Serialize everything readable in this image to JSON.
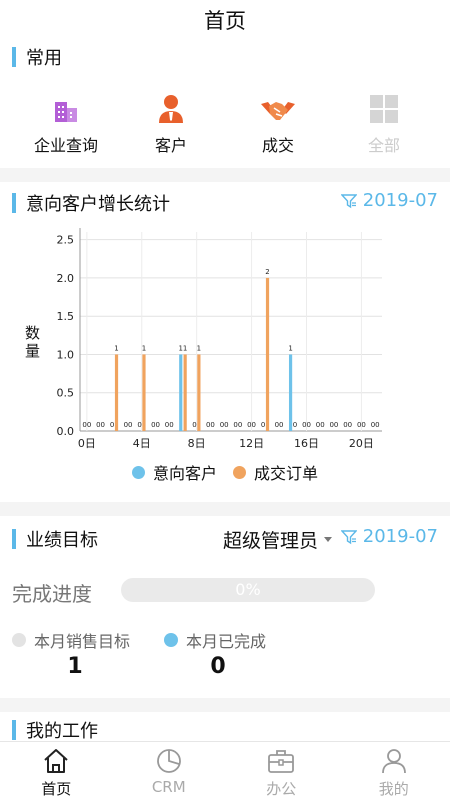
{
  "header": {
    "title": "首页"
  },
  "common": {
    "title": "常用",
    "items": [
      {
        "label": "企业查询",
        "icon": "building-icon",
        "enabled": true
      },
      {
        "label": "客户",
        "icon": "person-icon",
        "enabled": true
      },
      {
        "label": "成交",
        "icon": "handshake-icon",
        "enabled": true
      },
      {
        "label": "全部",
        "icon": "grid-icon",
        "enabled": false
      }
    ]
  },
  "growth": {
    "title": "意向客户增长统计",
    "filter_date": "2019-07",
    "ylabel": "数量",
    "legend": [
      {
        "label": "意向客户",
        "color": "#6ec2ea"
      },
      {
        "label": "成交订单",
        "color": "#f0a35e"
      }
    ]
  },
  "chart_data": {
    "type": "bar",
    "x": [
      0,
      1,
      2,
      3,
      4,
      5,
      6,
      7,
      8,
      9,
      10,
      11,
      12,
      13,
      14,
      15,
      16,
      17,
      18,
      19,
      20,
      21
    ],
    "xticks": [
      "0日",
      "4日",
      "8日",
      "12日",
      "16日",
      "20日"
    ],
    "xtick_values": [
      0,
      4,
      8,
      12,
      16,
      20
    ],
    "yticks": [
      "0.0",
      "0.5",
      "1.0",
      "1.5",
      "2.0",
      "2.5"
    ],
    "ylim": [
      0,
      2.6
    ],
    "series": [
      {
        "name": "意向客户",
        "color": "#6ec2ea",
        "values": [
          0,
          0,
          0,
          0,
          0,
          0,
          0,
          1,
          0,
          0,
          0,
          0,
          0,
          0,
          0,
          1,
          0,
          0,
          0,
          0,
          0,
          0
        ]
      },
      {
        "name": "成交订单",
        "color": "#f0a35e",
        "values": [
          0,
          0,
          1,
          0,
          1,
          0,
          0,
          1,
          1,
          0,
          0,
          0,
          0,
          2,
          0,
          0,
          0,
          0,
          0,
          0,
          0,
          0
        ]
      }
    ],
    "grid": true
  },
  "target": {
    "title": "业绩目标",
    "role": "超级管理员",
    "filter_date": "2019-07",
    "progress_label": "完成进度",
    "progress": 0,
    "progress_text": "0%",
    "monthly_target_label": "本月销售目标",
    "monthly_target_value": "1",
    "monthly_done_label": "本月已完成",
    "monthly_done_value": "0",
    "target_color": "#e3e3e3",
    "done_color": "#6ec2ea"
  },
  "work": {
    "title": "我的工作"
  },
  "tabbar": {
    "items": [
      {
        "label": "首页",
        "icon": "home-icon",
        "active": true
      },
      {
        "label": "CRM",
        "icon": "pie-chart-icon",
        "active": false
      },
      {
        "label": "办公",
        "icon": "briefcase-icon",
        "active": false
      },
      {
        "label": "我的",
        "icon": "user-icon",
        "active": false
      }
    ]
  }
}
